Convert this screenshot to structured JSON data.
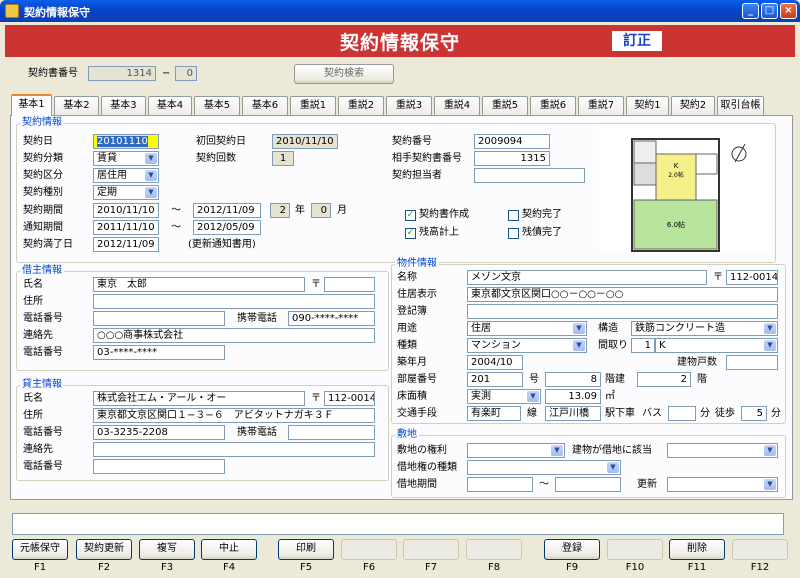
{
  "window": {
    "title": "契約情報保守"
  },
  "banner": {
    "title": "契約情報保守",
    "mode": "訂正"
  },
  "top": {
    "contract_no_label": "契約書番号",
    "contract_no_1": "1314",
    "dash": "−",
    "contract_no_2": "0",
    "search_button": "契約検索"
  },
  "tabs": [
    "基本1",
    "基本2",
    "基本3",
    "基本4",
    "基本5",
    "基本6",
    "重説1",
    "重説2",
    "重説3",
    "重説4",
    "重説5",
    "重説6",
    "重説7",
    "契約1",
    "契約2",
    "取引台帳"
  ],
  "keiyaku": {
    "group": "契約情報",
    "date_label": "契約日",
    "date": "20101110",
    "type_label": "契約分類",
    "type": "賃貸",
    "kubun_label": "契約区分",
    "kubun": "居住用",
    "shubetsu_label": "契約種別",
    "shubetsu": "定期",
    "period_label": "契約期間",
    "period_from": "2010/11/10",
    "tilde": "〜",
    "period_to": "2012/11/09",
    "years": "2",
    "year_unit": "年",
    "months": "0",
    "month_unit": "月",
    "notice_label": "通知期間",
    "notice_from": "2011/11/10",
    "notice_to": "2012/05/09",
    "expire_label": "契約満了日",
    "expire": "2012/11/09",
    "expire_note": "(更新通知書用)",
    "first_date_label": "初回契約日",
    "first_date": "2010/11/10",
    "count_label": "契約回数",
    "count": "1",
    "no_label": "契約番号",
    "no": "2009094",
    "partner_label": "相手契約書番号",
    "partner": "1315",
    "staff_label": "契約担当者",
    "staff": "",
    "chk_created": "契約書作成",
    "chk_done": "契約完了",
    "chk_rest": "残高計上",
    "chk_debt": "残債完了"
  },
  "kari": {
    "group": "借主情報",
    "name_label": "氏名",
    "name": "東京　太郎",
    "zip_mark": "〒",
    "zip": "",
    "addr_label": "住所",
    "addr": "",
    "tel_label": "電話番号",
    "tel": "",
    "mobile_label": "携帯電話",
    "mobile": "090-****-****",
    "contact_label": "連絡先",
    "contact": "○○○商事株式会社",
    "tel2_label": "電話番号",
    "tel2": "03-****-****"
  },
  "kashi": {
    "group": "貸主情報",
    "name_label": "氏名",
    "name": "株式会社エム・アール・オー",
    "zip_mark": "〒",
    "zip": "112-0014",
    "addr_label": "住所",
    "addr": "東京都文京区関口１−３−６　アビタットナガキ３Ｆ",
    "tel_label": "電話番号",
    "tel": "03-3235-2208",
    "mobile_label": "携帯電話",
    "mobile": "",
    "contact_label": "連絡先",
    "contact": "",
    "tel2_label": "電話番号",
    "tel2": ""
  },
  "bukken": {
    "group": "物件情報",
    "name_label": "名称",
    "name": "メゾン文京",
    "zip_mark": "〒",
    "zip": "112-0014",
    "addr_label": "住居表示",
    "addr": "東京都文京区関口○○－○○－○○",
    "reg_label": "登記簿",
    "reg": "",
    "use_label": "用途",
    "use": "住居",
    "struct_label": "構造",
    "struct": "鉄筋コンクリート造",
    "kind_label": "種類",
    "kind": "マンション",
    "madori_label": "間取り",
    "madori_n": "1",
    "madori": "K",
    "built_label": "築年月",
    "built": "2004/10",
    "units_label": "建物戸数",
    "units": "",
    "room_label": "部屋番号",
    "room": "201",
    "go": "号",
    "floor": "8",
    "floor_label": "階建",
    "floor2": "2",
    "floor2_label": "階",
    "area_label": "床面積",
    "area_type": "実測",
    "area": "13.09",
    "area_unit": "㎡",
    "traffic_label": "交通手段",
    "line": "有楽町",
    "line_unit": "線",
    "station": "江戸川橋",
    "station_unit": "駅下車",
    "bus_label": "バス",
    "bus": "",
    "min1": "分",
    "walk_label": "徒歩",
    "walk": "5",
    "min2": "分"
  },
  "shikichi": {
    "group": "敷地",
    "right_label": "敷地の権利",
    "right": "",
    "leased_label": "建物が借地に該当",
    "leased": "",
    "kind_label": "借地権の種類",
    "kind": "",
    "period_label": "借地期間",
    "from": "",
    "tilde": "〜",
    "to": "",
    "renew_label": "更新",
    "renew": ""
  },
  "floorplan": {
    "room_label": "K",
    "room_size": "2.0帖",
    "main_label": "6.0帖"
  },
  "fkeys": [
    {
      "label": "元帳保守",
      "key": "F1"
    },
    {
      "label": "契約更新",
      "key": "F2"
    },
    {
      "label": "複写",
      "key": "F3"
    },
    {
      "label": "中止",
      "key": "F4"
    },
    {
      "label": "印刷",
      "key": "F5"
    },
    {
      "label": "",
      "key": "F6"
    },
    {
      "label": "",
      "key": "F7"
    },
    {
      "label": "",
      "key": "F8"
    },
    {
      "label": "登録",
      "key": "F9"
    },
    {
      "label": "",
      "key": "F10"
    },
    {
      "label": "削除",
      "key": "F11"
    },
    {
      "label": "",
      "key": "F12"
    }
  ]
}
